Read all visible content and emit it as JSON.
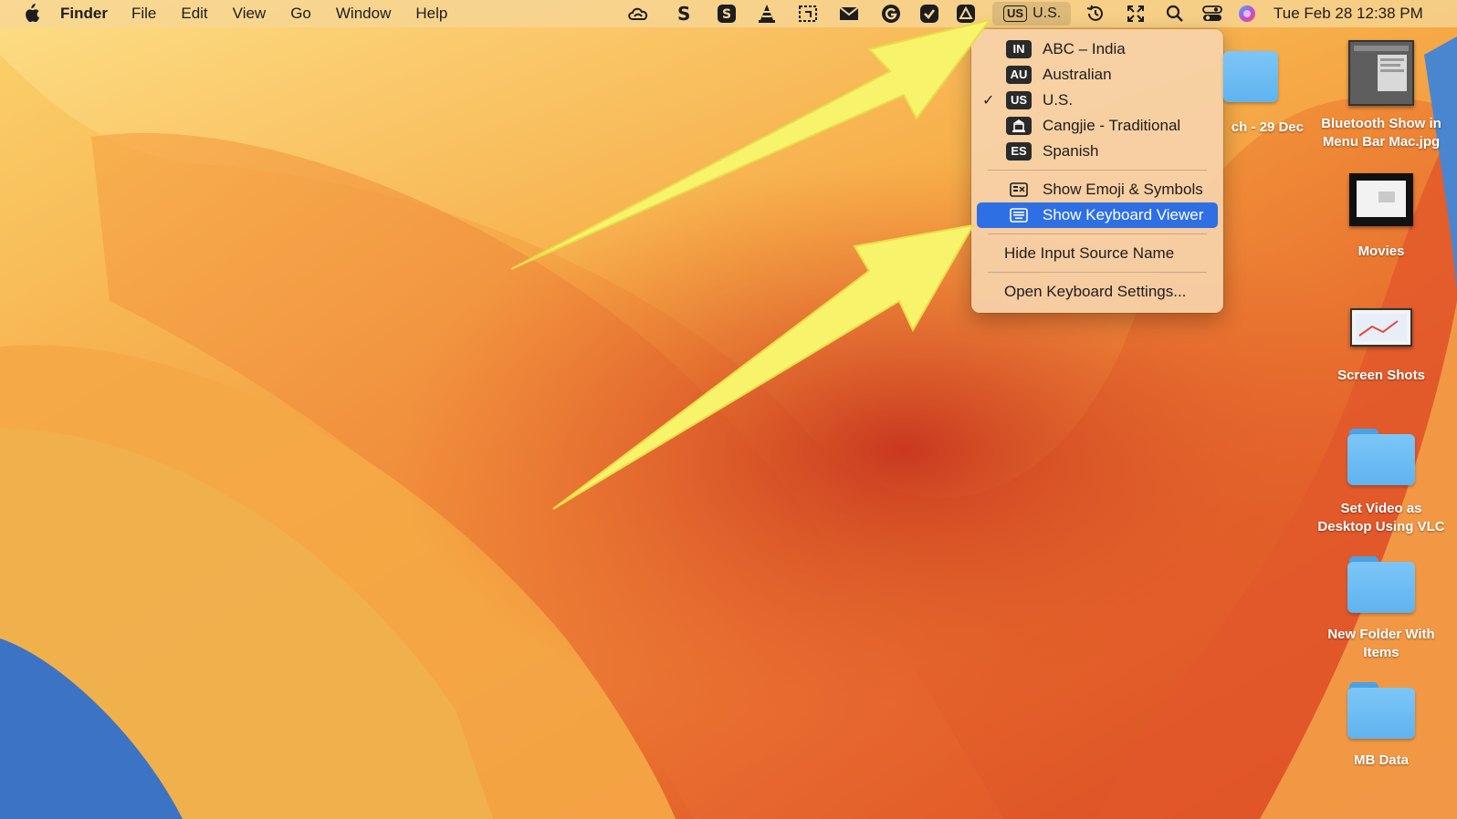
{
  "menubar": {
    "app_name": "Finder",
    "menus": [
      "File",
      "Edit",
      "View",
      "Go",
      "Window",
      "Help"
    ],
    "status_icons": [
      "creative-cloud-icon",
      "scrivener-icon",
      "s-app-icon",
      "vlc-icon",
      "screenshot-selection-icon",
      "inbox-icon",
      "grammarly-icon",
      "checkmark-app-icon",
      "alert-app-icon",
      "time-machine-icon",
      "fullscreen-icon",
      "spotlight-search-icon",
      "control-center-icon",
      "siri-icon"
    ],
    "input_source": {
      "badge": "US",
      "name": "U.S."
    },
    "clock": "Tue Feb 28  12:38 PM"
  },
  "input_menu": {
    "sources": [
      {
        "badge": "IN",
        "label": "ABC – India",
        "checked": false
      },
      {
        "badge": "AU",
        "label": "Australian",
        "checked": false
      },
      {
        "badge": "US",
        "label": "U.S.",
        "checked": true
      },
      {
        "badge": "",
        "label": "Cangjie - Traditional",
        "checked": false
      },
      {
        "badge": "ES",
        "label": "Spanish",
        "checked": false
      }
    ],
    "check_mark": "✓",
    "show_emoji": "Show Emoji & Symbols",
    "show_keyboard_viewer": "Show Keyboard Viewer",
    "hide_input_source_name": "Hide Input Source Name",
    "open_keyboard_settings": "Open Keyboard Settings..."
  },
  "desktop": {
    "partial_item_label": "ch - 29 Dec",
    "items": [
      {
        "label": "Bluetooth Show in Menu Bar Mac.jpg",
        "kind": "screenshot-thumbnail"
      },
      {
        "label": "Movies",
        "kind": "movies-thumbnail"
      },
      {
        "label": "Screen Shots",
        "kind": "screenshots-thumbnail"
      },
      {
        "label": "Set Video as Desktop Using VLC",
        "kind": "folder"
      },
      {
        "label": "New Folder With Items",
        "kind": "folder"
      },
      {
        "label": "MB Data",
        "kind": "folder"
      }
    ]
  },
  "colors": {
    "highlight": "#2f6fe4",
    "arrow": "#f7f36a",
    "folder": "#6bbcf4"
  }
}
